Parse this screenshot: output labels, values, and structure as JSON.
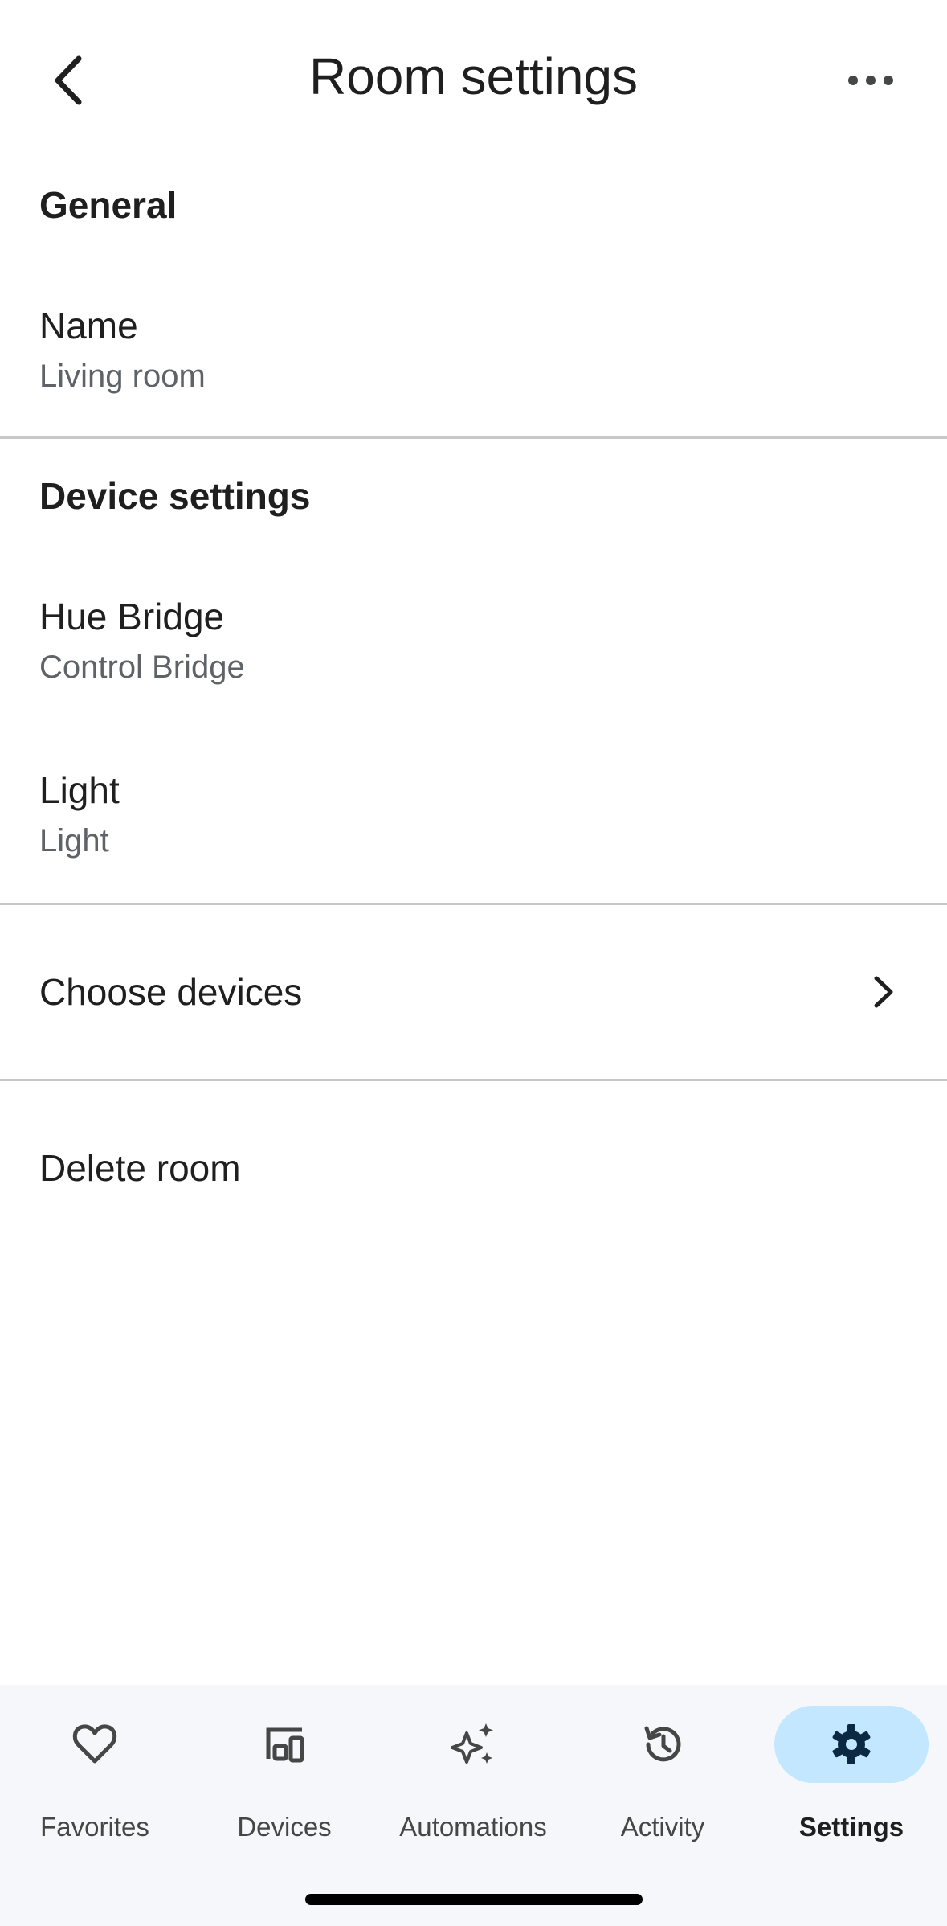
{
  "header": {
    "title": "Room settings"
  },
  "general": {
    "section_label": "General",
    "name_label": "Name",
    "name_value": "Living room"
  },
  "device_settings": {
    "section_label": "Device settings",
    "devices": [
      {
        "title": "Hue Bridge",
        "subtitle": "Control Bridge"
      },
      {
        "title": "Light",
        "subtitle": "Light"
      }
    ]
  },
  "actions": {
    "choose_devices": "Choose devices",
    "delete_room": "Delete room"
  },
  "bottom_nav": {
    "items": [
      {
        "label": "Favorites",
        "icon": "heart-icon",
        "active": false
      },
      {
        "label": "Devices",
        "icon": "devices-icon",
        "active": false
      },
      {
        "label": "Automations",
        "icon": "sparkle-icon",
        "active": false
      },
      {
        "label": "Activity",
        "icon": "history-icon",
        "active": false
      },
      {
        "label": "Settings",
        "icon": "gear-icon",
        "active": true
      }
    ]
  },
  "colors": {
    "active_nav_pill": "#c2e7ff",
    "nav_background": "#f5f7fa",
    "divider": "#c7c7c7",
    "secondary_text": "#5f6368"
  }
}
